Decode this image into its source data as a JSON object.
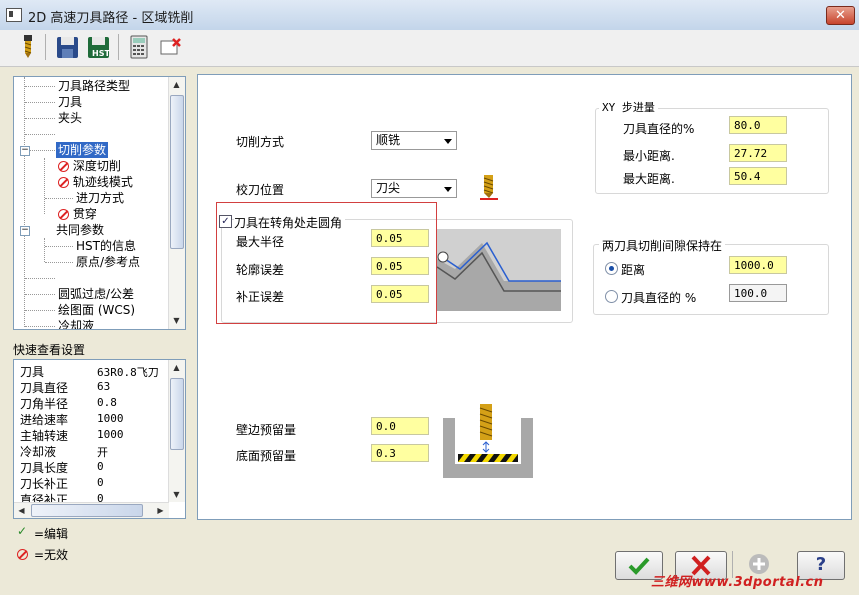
{
  "window": {
    "title": "2D 高速刀具路径 - 区域铣削",
    "close_glyph": "✕"
  },
  "toolbar": {
    "icons": [
      "tool-icon",
      "save-icon",
      "save-as-hst-icon",
      "calculator-icon",
      "clear-icon"
    ]
  },
  "tree": {
    "items": [
      {
        "label": "刀具路径类型"
      },
      {
        "label": "刀具"
      },
      {
        "label": "夹头"
      },
      {
        "label": "切削参数",
        "selected": true
      },
      {
        "label": "深度切削",
        "disabled": true
      },
      {
        "label": "轨迹线模式",
        "disabled": true
      },
      {
        "label": "进刀方式"
      },
      {
        "label": "贯穿",
        "disabled": true
      },
      {
        "label": "共同参数"
      },
      {
        "label": "HST的信息"
      },
      {
        "label": "原点/参考点"
      },
      {
        "label": "圆弧过虑/公差"
      },
      {
        "label": "绘图面 (WCS)"
      },
      {
        "label": "冷却液"
      }
    ]
  },
  "quick_view": {
    "title": "快速查看设置",
    "rows": [
      {
        "key": "刀具",
        "value": "63R0.8飞刀"
      },
      {
        "key": "刀具直径",
        "value": "63"
      },
      {
        "key": "刀角半径",
        "value": "0.8"
      },
      {
        "key": "进给速率",
        "value": "1000"
      },
      {
        "key": "主轴转速",
        "value": "1000"
      },
      {
        "key": "冷却液",
        "value": "开"
      },
      {
        "key": "刀具长度",
        "value": "0"
      },
      {
        "key": "刀长补正",
        "value": "0"
      },
      {
        "key": "直径补正",
        "value": "0"
      }
    ]
  },
  "legend": {
    "edit_label": "=编辑",
    "invalid_label": "=无效"
  },
  "main": {
    "cut_method_label": "切削方式",
    "cut_method_value": "顺铣",
    "tool_pos_label": "校刀位置",
    "tool_pos_value": "刀尖",
    "corner_round": {
      "checkbox_label": "刀具在转角处走圆角",
      "checked": true,
      "max_radius_label": "最大半径",
      "max_radius_value": "0.05",
      "profile_tol_label": "轮廓误差",
      "profile_tol_value": "0.05",
      "offset_tol_label": "补正误差",
      "offset_tol_value": "0.05"
    },
    "stock": {
      "wall_label": "壁边预留量",
      "wall_value": "0.0",
      "floor_label": "底面预留量",
      "floor_value": "0.3"
    }
  },
  "xy_stepover": {
    "title": "XY 步进量",
    "diameter_pct_label": "刀具直径的%",
    "diameter_pct_value": "80.0",
    "min_dist_label": "最小距离.",
    "min_dist_value": "27.72",
    "max_dist_label": "最大距离.",
    "max_dist_value": "50.4"
  },
  "gap": {
    "title": "两刀具切削间隙保持在",
    "distance_label": "距离",
    "distance_value": "1000.0",
    "distance_selected": true,
    "tool_dia_label": "刀具直径的 %",
    "tool_dia_value": "100.0"
  },
  "buttons": {
    "ok_icon": "check-icon",
    "cancel_icon": "x-icon",
    "add_icon": "plus-icon",
    "help_glyph": "?"
  },
  "watermark": "三维网www.3dportal.cn"
}
